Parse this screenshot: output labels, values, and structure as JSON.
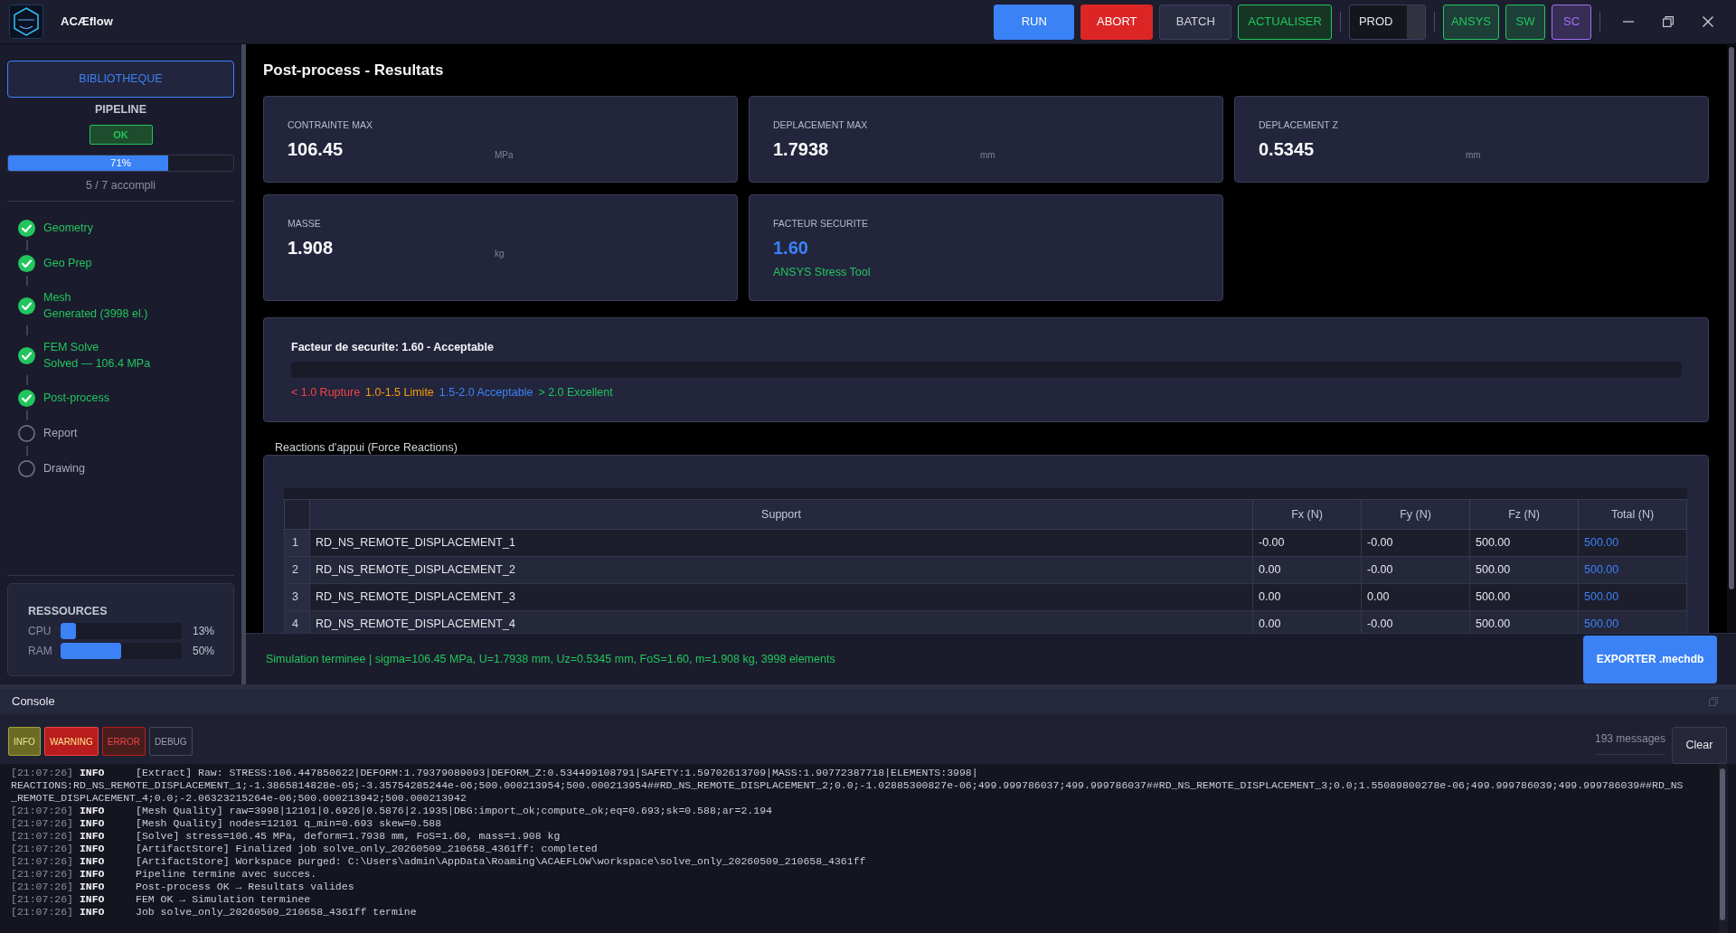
{
  "app": {
    "title": "ACÆflow"
  },
  "toolbar": {
    "buttons": [
      {
        "label": "RUN",
        "kind": "primary"
      },
      {
        "label": "ABORT",
        "kind": "danger"
      },
      {
        "label": "BATCH",
        "kind": "neutral"
      },
      {
        "label": "ACTUALISER",
        "kind": "success"
      }
    ],
    "profile": {
      "value": "PROD"
    },
    "tools": [
      {
        "label": "ANSYS",
        "color": "#22c55e"
      },
      {
        "label": "SW",
        "color": "#22c55e"
      },
      {
        "label": "SC",
        "color": "#a371f7"
      }
    ]
  },
  "sidebar": {
    "library_button": "BIBLIOTHEQUE",
    "pipeline": {
      "title": "PIPELINE",
      "status": "OK",
      "level": 0.71,
      "reading": "71%",
      "summary": "5 / 7 accompli",
      "steps": [
        {
          "name": "Geometry",
          "done": true
        },
        {
          "name": "Geo Prep",
          "done": true
        },
        {
          "name": "Mesh",
          "detail": "Generated (3998 el.)",
          "done": true
        },
        {
          "name": "FEM Solve",
          "detail": "Solved — 106.4 MPa",
          "done": true
        },
        {
          "name": "Post-process",
          "done": true
        },
        {
          "name": "Report",
          "done": false
        },
        {
          "name": "Drawing",
          "done": false
        }
      ]
    },
    "resources": {
      "title": "RESSOURCES",
      "meters": [
        {
          "name": "CPU",
          "level": 0.13,
          "reading": "13%"
        },
        {
          "name": "RAM",
          "level": 0.5,
          "reading": "50%"
        }
      ]
    }
  },
  "results": {
    "title": "Post-process - Resultats",
    "cards": [
      {
        "label": "CONTRAINTE MAX",
        "value": "106.45",
        "unit": "MPa",
        "kind": "plain"
      },
      {
        "label": "DEPLACEMENT MAX",
        "value": "1.7938",
        "unit": "mm",
        "kind": "plain"
      },
      {
        "label": "DEPLACEMENT Z",
        "value": "0.5345",
        "unit": "mm",
        "kind": "plain"
      },
      {
        "label": "MASSE",
        "value": "1.908",
        "unit": "kg",
        "kind": "plain"
      },
      {
        "label": "FACTEUR SECURITE",
        "value": "1.60",
        "source": "ANSYS Stress Tool",
        "kind": "highlight"
      }
    ]
  },
  "safety": {
    "title": "Facteur de securite: 1.60 - Acceptable",
    "legend": [
      {
        "label": "< 1.0 Rupture",
        "color": "#ef4444"
      },
      {
        "label": "1.0-1.5 Limite",
        "color": "#f59e0b"
      },
      {
        "label": "1.5-2.0 Acceptable",
        "color": "#3b82f6"
      },
      {
        "label": "> 2.0 Excellent",
        "color": "#22c55e"
      }
    ]
  },
  "reactions": {
    "title": "Reactions d'appui (Force Reactions)",
    "columns": [
      "Support",
      "Fx (N)",
      "Fy (N)",
      "Fz (N)",
      "Total (N)"
    ],
    "rows": [
      {
        "index": "1",
        "cells": [
          "RD_NS_REMOTE_DISPLACEMENT_1",
          "-0.00",
          "-0.00",
          "500.00",
          "500.00"
        ]
      },
      {
        "index": "2",
        "cells": [
          "RD_NS_REMOTE_DISPLACEMENT_2",
          "0.00",
          "-0.00",
          "500.00",
          "500.00"
        ]
      },
      {
        "index": "3",
        "cells": [
          "RD_NS_REMOTE_DISPLACEMENT_3",
          "0.00",
          "0.00",
          "500.00",
          "500.00"
        ]
      },
      {
        "index": "4",
        "cells": [
          "RD_NS_REMOTE_DISPLACEMENT_4",
          "0.00",
          "-0.00",
          "500.00",
          "500.00"
        ]
      }
    ]
  },
  "status_bar": {
    "message": "Simulation terminee | sigma=106.45 MPa, U=1.7938 mm, Uz=0.5345 mm, FoS=1.60, m=1.908 kg, 3998 elements",
    "button": "EXPORTER .mechdb"
  },
  "console": {
    "title": "Console",
    "filters": [
      {
        "label": "INFO",
        "kind": "info",
        "checked": true
      },
      {
        "label": "WARNING",
        "kind": "warning",
        "checked": true
      },
      {
        "label": "ERROR",
        "kind": "error",
        "checked": true
      },
      {
        "label": "DEBUG",
        "kind": "debug",
        "checked": false
      }
    ],
    "count": "193 messages",
    "clear_button": "Clear",
    "lines": [
      {
        "time": "[21:07:26]",
        "level": "INFO",
        "text": "[Extract] Raw: STRESS:106.447850622|DEFORM:1.79379089093|DEFORM_Z:0.534499108791|SAFETY:1.59702613709|MASS:1.90772387718|ELEMENTS:3998|"
      },
      {
        "text": "REACTIONS:RD_NS_REMOTE_DISPLACEMENT_1;-1.3865814828e-05;-3.35754285244e-06;500.000213954;500.000213954##RD_NS_REMOTE_DISPLACEMENT_2;0.0;-1.02885300827e-06;499.999786037;499.999786037##RD_NS_REMOTE_DISPLACEMENT_3;0.0;1.55089800278e-06;499.999786039;499.999786039##RD_NS"
      },
      {
        "text": "_REMOTE_DISPLACEMENT_4;0.0;-2.06323215264e-06;500.000213942;500.000213942"
      },
      {
        "time": "[21:07:26]",
        "level": "INFO",
        "text": "[Mesh Quality] raw=3998|12101|0.6926|0.5876|2.1935|DBG:import_ok;compute_ok;eq=0.693;sk=0.588;ar=2.194"
      },
      {
        "time": "[21:07:26]",
        "level": "INFO",
        "text": "[Mesh Quality] nodes=12101 q_min=0.693 skew=0.588"
      },
      {
        "time": "[21:07:26]",
        "level": "INFO",
        "text": "[Solve] stress=106.45 MPa, deform=1.7938 mm, FoS=1.60, mass=1.908 kg"
      },
      {
        "time": "[21:07:26]",
        "level": "INFO",
        "text": "[ArtifactStore] Finalized job solve_only_20260509_210658_4361ff: completed"
      },
      {
        "time": "[21:07:26]",
        "level": "INFO",
        "text": "[ArtifactStore] Workspace purged: C:\\Users\\admin\\AppData\\Roaming\\ACAEFLOW\\workspace\\solve_only_20260509_210658_4361ff"
      },
      {
        "time": "[21:07:26]",
        "level": "INFO",
        "text": "Pipeline termine avec succes."
      },
      {
        "time": "[21:07:26]",
        "level": "INFO",
        "text": "Post-process OK → Resultats valides"
      },
      {
        "time": "[21:07:26]",
        "level": "INFO",
        "text": "FEM OK → Simulation terminee"
      },
      {
        "time": "[21:07:26]",
        "level": "INFO",
        "text": "Job solve_only_20260509_210658_4361ff termine"
      }
    ]
  }
}
